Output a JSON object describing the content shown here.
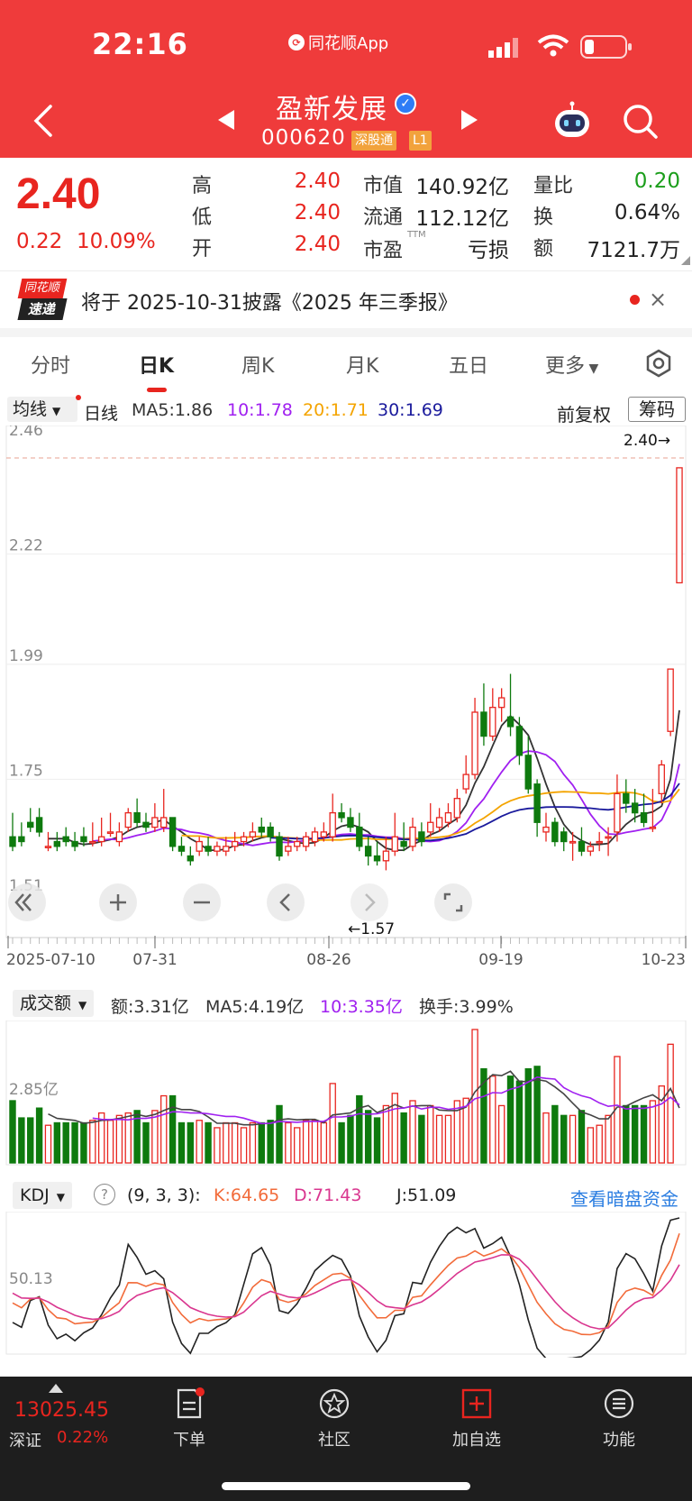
{
  "status": {
    "time": "22:16",
    "app": "同花顺App"
  },
  "stock": {
    "name": "盈新发展",
    "code": "000620",
    "tag1": "深股通",
    "tag2": "L1"
  },
  "quote": {
    "price": "2.40",
    "change": "0.22",
    "change_pct": "10.09%",
    "high_label": "高",
    "high": "2.40",
    "low_label": "低",
    "low": "2.40",
    "open_label": "开",
    "open": "2.40",
    "mktcap_label": "市值",
    "mktcap": "140.92亿",
    "float_label": "流通",
    "float": "112.12亿",
    "pe_label": "市盈",
    "pe_sup": "TTM",
    "pe": "亏损",
    "volratio_label": "量比",
    "volratio": "0.20",
    "turnover_label": "换",
    "turnover": "0.64%",
    "amount_label": "额",
    "amount": "7121.7万"
  },
  "notice": {
    "logo_line1": "同花顺",
    "logo_line2": "速递",
    "text": "将于 2025-10-31披露《2025 年三季报》",
    "close": "×"
  },
  "tabs": [
    "分时",
    "日K",
    "周K",
    "月K",
    "五日",
    "更多"
  ],
  "ma_row": {
    "select": "均线",
    "type": "日线",
    "ma5": "MA5:1.86",
    "ma10": "10:1.78",
    "ma20": "20:1.71",
    "ma30": "30:1.69",
    "adjust": "前复权",
    "chips": "筹码",
    "colors": {
      "ma5": "#333333",
      "ma10": "#a020f0",
      "ma20": "#f4a400",
      "ma30": "#1a1a9c"
    }
  },
  "kline": {
    "y_labels": [
      "2.46",
      "2.22",
      "1.99",
      "1.75",
      "1.51"
    ],
    "last_price_label": "2.40→",
    "min_label": "←1.57",
    "dates": [
      "2025-07-10",
      "07-31",
      "08-26",
      "09-19",
      "10-23"
    ]
  },
  "volume": {
    "select": "成交额",
    "amount": "额:3.31亿",
    "ma5": "MA5:4.19亿",
    "ma10": "10:3.35亿",
    "turnover": "换手:3.99%",
    "y_label": "2.85亿"
  },
  "kdj": {
    "select": "KDJ",
    "help": "?",
    "params": "(9, 3, 3):",
    "k": "K:64.65",
    "d": "D:71.43",
    "j": "J:51.09",
    "link": "查看暗盘资金",
    "y_label": "50.13"
  },
  "bottom": {
    "index_value": "13025.45",
    "index_name": "深证",
    "index_pct": "0.22%",
    "nav": [
      "下单",
      "社区",
      "加自选",
      "功能"
    ]
  },
  "chart_data": {
    "type": "candlestick",
    "title": "",
    "xlabel": "",
    "ylabel": "",
    "ylim": [
      1.51,
      2.46
    ],
    "x": [
      "2025-07-10",
      "07-31",
      "08-26",
      "09-19",
      "10-23"
    ],
    "series": [
      {
        "ohlc": [
          [
            1.63,
            1.68,
            1.61,
            1.6
          ],
          [
            1.63,
            1.66,
            1.62,
            1.61
          ],
          [
            1.66,
            1.69,
            1.65,
            1.64
          ],
          [
            1.67,
            1.69,
            1.64,
            1.63
          ],
          [
            1.61,
            1.64,
            1.61,
            1.6
          ],
          [
            1.62,
            1.64,
            1.61,
            1.6
          ],
          [
            1.63,
            1.65,
            1.62,
            1.61
          ],
          [
            1.62,
            1.64,
            1.61,
            1.6
          ],
          [
            1.63,
            1.65,
            1.62,
            1.61
          ],
          [
            1.62,
            1.66,
            1.62,
            1.61
          ],
          [
            1.62,
            1.67,
            1.63,
            1.61
          ],
          [
            1.64,
            1.68,
            1.64,
            1.63
          ],
          [
            1.62,
            1.66,
            1.64,
            1.61
          ],
          [
            1.65,
            1.69,
            1.68,
            1.64
          ],
          [
            1.68,
            1.71,
            1.66,
            1.65
          ],
          [
            1.66,
            1.68,
            1.65,
            1.64
          ],
          [
            1.65,
            1.7,
            1.67,
            1.64
          ],
          [
            1.65,
            1.73,
            1.67,
            1.64
          ],
          [
            1.67,
            1.67,
            1.61,
            1.6
          ],
          [
            1.61,
            1.63,
            1.6,
            1.59
          ],
          [
            1.59,
            1.61,
            1.58,
            1.57
          ],
          [
            1.6,
            1.63,
            1.62,
            1.59
          ],
          [
            1.61,
            1.63,
            1.6,
            1.59
          ],
          [
            1.6,
            1.62,
            1.61,
            1.59
          ],
          [
            1.6,
            1.63,
            1.61,
            1.59
          ],
          [
            1.61,
            1.64,
            1.62,
            1.6
          ],
          [
            1.62,
            1.64,
            1.63,
            1.61
          ],
          [
            1.63,
            1.66,
            1.64,
            1.62
          ],
          [
            1.65,
            1.67,
            1.64,
            1.63
          ],
          [
            1.65,
            1.66,
            1.63,
            1.62
          ],
          [
            1.63,
            1.64,
            1.59,
            1.58
          ],
          [
            1.6,
            1.63,
            1.61,
            1.59
          ],
          [
            1.61,
            1.63,
            1.62,
            1.6
          ],
          [
            1.61,
            1.64,
            1.63,
            1.6
          ],
          [
            1.62,
            1.65,
            1.64,
            1.61
          ],
          [
            1.63,
            1.66,
            1.64,
            1.62
          ],
          [
            1.63,
            1.72,
            1.68,
            1.62
          ],
          [
            1.68,
            1.7,
            1.67,
            1.66
          ],
          [
            1.67,
            1.69,
            1.65,
            1.64
          ],
          [
            1.65,
            1.68,
            1.61,
            1.6
          ],
          [
            1.61,
            1.63,
            1.59,
            1.57
          ],
          [
            1.59,
            1.62,
            1.58,
            1.57
          ],
          [
            1.58,
            1.63,
            1.6,
            1.56
          ],
          [
            1.6,
            1.68,
            1.63,
            1.59
          ],
          [
            1.62,
            1.66,
            1.61,
            1.6
          ],
          [
            1.61,
            1.67,
            1.65,
            1.6
          ],
          [
            1.64,
            1.66,
            1.62,
            1.61
          ],
          [
            1.64,
            1.7,
            1.66,
            1.63
          ],
          [
            1.65,
            1.69,
            1.67,
            1.64
          ],
          [
            1.66,
            1.7,
            1.68,
            1.65
          ],
          [
            1.67,
            1.73,
            1.71,
            1.66
          ],
          [
            1.73,
            1.8,
            1.76,
            1.72
          ],
          [
            1.76,
            1.92,
            1.89,
            1.75
          ],
          [
            1.89,
            1.95,
            1.84,
            1.82
          ],
          [
            1.84,
            1.94,
            1.9,
            1.83
          ],
          [
            1.9,
            1.94,
            1.92,
            1.87
          ],
          [
            1.88,
            1.97,
            1.86,
            1.84
          ],
          [
            1.86,
            1.88,
            1.8,
            1.78
          ],
          [
            1.8,
            1.84,
            1.73,
            1.72
          ],
          [
            1.74,
            1.75,
            1.66,
            1.63
          ],
          [
            1.64,
            1.68,
            1.65,
            1.62
          ],
          [
            1.66,
            1.67,
            1.62,
            1.61
          ],
          [
            1.64,
            1.65,
            1.62,
            1.6
          ],
          [
            1.62,
            1.64,
            1.62,
            1.58
          ],
          [
            1.62,
            1.65,
            1.6,
            1.59
          ],
          [
            1.6,
            1.62,
            1.61,
            1.59
          ],
          [
            1.62,
            1.64,
            1.62,
            1.6
          ],
          [
            1.63,
            1.65,
            1.63,
            1.59
          ],
          [
            1.64,
            1.76,
            1.72,
            1.62
          ],
          [
            1.72,
            1.75,
            1.7,
            1.68
          ],
          [
            1.7,
            1.73,
            1.68,
            1.66
          ],
          [
            1.68,
            1.72,
            1.66,
            1.65
          ],
          [
            1.65,
            1.73,
            1.65,
            1.64
          ],
          [
            1.72,
            1.79,
            1.78,
            1.7
          ],
          [
            1.85,
            1.98,
            1.98,
            1.84
          ],
          [
            2.16,
            2.16,
            2.4,
            2.4
          ]
        ]
      }
    ]
  }
}
